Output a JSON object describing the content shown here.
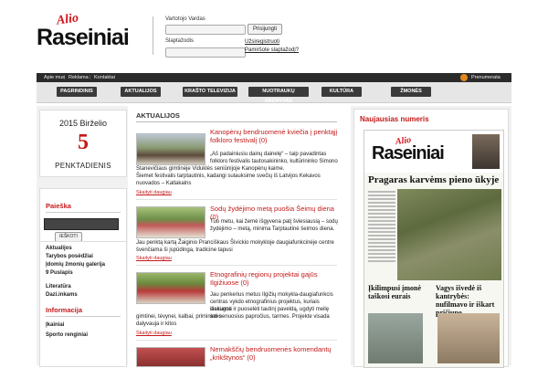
{
  "header": {
    "logo_small": "Alio",
    "logo_main": "Raseiniai",
    "username_label": "Vartotojo Vardas",
    "password_label": "Slaptažodis",
    "login_button": "Prisijungti",
    "register_link": "Užsiregistruoti",
    "forgot_link": "Pamiršote slaptažodį?"
  },
  "topbar": {
    "links": [
      "Apie mus",
      "Reklama",
      "Kontaktai"
    ],
    "subscribe": "Prenumerata"
  },
  "nav": {
    "items": [
      "PAGRINDINIS",
      "AKTUALIJOS",
      "KRAŠTO TELEVIZIJA",
      "NUOTRAUKŲ ARCHYVAS",
      "KULTŪRA",
      "ŽMONĖS"
    ]
  },
  "date": {
    "line1": "2015 Birželio",
    "day": "5",
    "weekday": "PENKTADIENIS"
  },
  "search": {
    "title": "Paieška",
    "button": "IEŠKOTI"
  },
  "menu": {
    "items": [
      "Aktualijos",
      "Tarybos posėdžiai",
      "Įdomių žmonių galerija",
      "9 Puslapis",
      "Literatūra",
      "Dazi.inkams"
    ],
    "info_title": "Informacija",
    "info_items": [
      "Įkainiai",
      "Sporto renginiai"
    ]
  },
  "center": {
    "section_title": "AKTUALIJOS",
    "more_label": "Skaityti daugiau",
    "articles": [
      {
        "title": "Kanopėnų bendruomenė kviečia į penktąjį folkloro festivalį (0)",
        "text_lines": [
          "„Aš padainiusiu dainų dainelę“ – taip pavadintas",
          "folkloro festivalis tautosakininko, kultūrininko Simono",
          "Stanevičiaus gimtinėje Viduklės seniūnijoje Kanopėnų kaime.",
          "Šiemet festivalis tarptautinis, kadangi sulauksime svečių iš Latvijos Kekavos",
          "nuovados – Katlakalns"
        ]
      },
      {
        "title": "Sodų žydėjimo metą puošia Šeimų diena (0)",
        "text_lines": [
          "Tuo metu, kai žemė išgyvena patį šviesiausią – sodų",
          "žydėjimo – metą, minima Tarptautinė šeimos diena.",
          "Jau penktą kartą Žaiginio Pranciškaus Šivickio mokykloje daugiafunkcinėje centre",
          "švenčiama ši įspūdinga, tradicine tapusi"
        ]
      },
      {
        "title": "Etnografinių regionų projektai gajūs Ilgižiuose (0)",
        "text_lines": [
          "Jau penkerius metus Ilgižių mokykla-daugiafunkcis",
          "centras vykdo etnografinius projektus, kuriais siekiama",
          "išsaugoti ir puoselėti tautinį paveldą, ugdyti meilę savo",
          "gimtinei, tėvynei, kalbai, primininti senuosius papročius, tarmes. Projekte visada",
          "dalyvauja ir kitos"
        ]
      },
      {
        "title": "Nemakščių bendruomenės komendantų „krikštynos“ (0)",
        "text_lines": []
      }
    ]
  },
  "right": {
    "title": "Naujausias numeris",
    "paper_logo_small": "Alio",
    "paper_logo_main": "Raseiniai",
    "headline": "Pragaras karvėms pieno ūkyje",
    "sub1": "Įkilimpusi įmonė taškosi eurais",
    "sub2": "Vagys išvedė iš kantrybės: nufilmavo ir iškart pričiupo"
  },
  "colors": {
    "accent": "#c31a1a",
    "nav_button": "#3a3a3a",
    "topbar": "#2b2b2b"
  }
}
